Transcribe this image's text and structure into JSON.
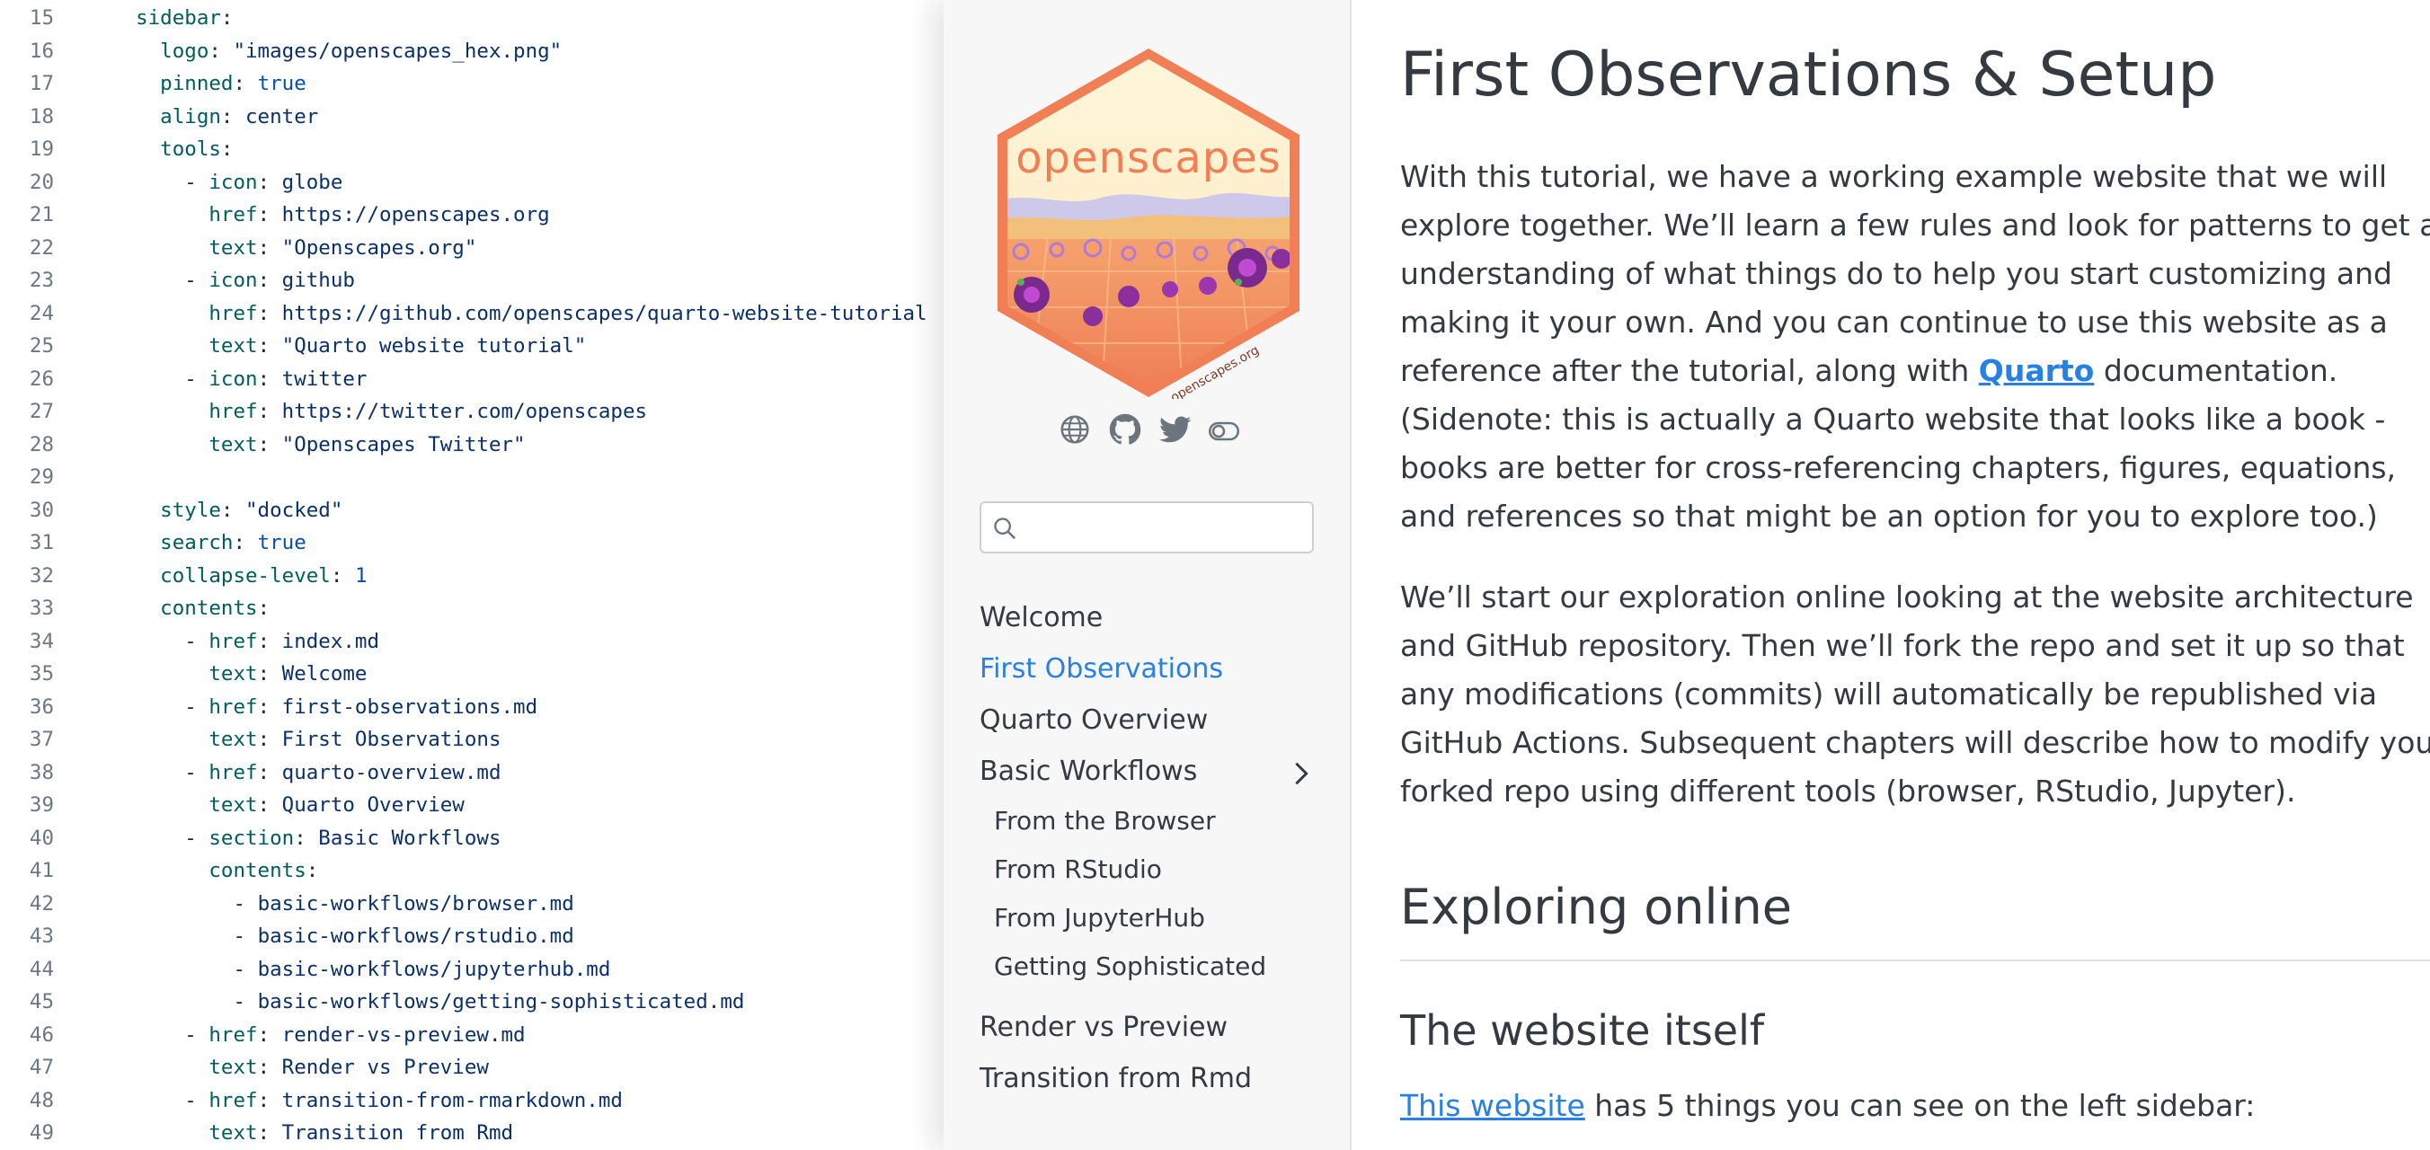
{
  "code": {
    "lines": [
      {
        "n": "15",
        "parts": [
          {
            "c": "k",
            "t": "  sidebar"
          },
          {
            "c": "p",
            "t": ":"
          }
        ]
      },
      {
        "n": "16",
        "parts": [
          {
            "c": "k",
            "t": "    logo"
          },
          {
            "c": "p",
            "t": ": "
          },
          {
            "c": "s",
            "t": "\"images/openscapes_hex.png\""
          }
        ]
      },
      {
        "n": "17",
        "parts": [
          {
            "c": "k",
            "t": "    pinned"
          },
          {
            "c": "p",
            "t": ": "
          },
          {
            "c": "n",
            "t": "true"
          }
        ]
      },
      {
        "n": "18",
        "parts": [
          {
            "c": "k",
            "t": "    align"
          },
          {
            "c": "p",
            "t": ": "
          },
          {
            "c": "s",
            "t": "center"
          }
        ]
      },
      {
        "n": "19",
        "parts": [
          {
            "c": "k",
            "t": "    tools"
          },
          {
            "c": "p",
            "t": ":"
          }
        ]
      },
      {
        "n": "20",
        "parts": [
          {
            "c": "p",
            "t": "      - "
          },
          {
            "c": "k",
            "t": "icon"
          },
          {
            "c": "p",
            "t": ": "
          },
          {
            "c": "s",
            "t": "globe"
          }
        ]
      },
      {
        "n": "21",
        "parts": [
          {
            "c": "k",
            "t": "        href"
          },
          {
            "c": "p",
            "t": ": "
          },
          {
            "c": "s",
            "t": "https://openscapes.org"
          }
        ]
      },
      {
        "n": "22",
        "parts": [
          {
            "c": "k",
            "t": "        text"
          },
          {
            "c": "p",
            "t": ": "
          },
          {
            "c": "s",
            "t": "\"Openscapes.org\""
          }
        ]
      },
      {
        "n": "23",
        "parts": [
          {
            "c": "p",
            "t": "      - "
          },
          {
            "c": "k",
            "t": "icon"
          },
          {
            "c": "p",
            "t": ": "
          },
          {
            "c": "s",
            "t": "github"
          }
        ]
      },
      {
        "n": "24",
        "parts": [
          {
            "c": "k",
            "t": "        href"
          },
          {
            "c": "p",
            "t": ": "
          },
          {
            "c": "s",
            "t": "https://github.com/openscapes/quarto-website-tutorial"
          }
        ]
      },
      {
        "n": "25",
        "parts": [
          {
            "c": "k",
            "t": "        text"
          },
          {
            "c": "p",
            "t": ": "
          },
          {
            "c": "s",
            "t": "\"Quarto website tutorial\""
          }
        ]
      },
      {
        "n": "26",
        "parts": [
          {
            "c": "p",
            "t": "      - "
          },
          {
            "c": "k",
            "t": "icon"
          },
          {
            "c": "p",
            "t": ": "
          },
          {
            "c": "s",
            "t": "twitter"
          }
        ]
      },
      {
        "n": "27",
        "parts": [
          {
            "c": "k",
            "t": "        href"
          },
          {
            "c": "p",
            "t": ": "
          },
          {
            "c": "s",
            "t": "https://twitter.com/openscapes"
          }
        ]
      },
      {
        "n": "28",
        "parts": [
          {
            "c": "k",
            "t": "        text"
          },
          {
            "c": "p",
            "t": ": "
          },
          {
            "c": "s",
            "t": "\"Openscapes Twitter\""
          }
        ]
      },
      {
        "n": "29",
        "parts": []
      },
      {
        "n": "30",
        "parts": [
          {
            "c": "k",
            "t": "    style"
          },
          {
            "c": "p",
            "t": ": "
          },
          {
            "c": "s",
            "t": "\"docked\""
          }
        ]
      },
      {
        "n": "31",
        "parts": [
          {
            "c": "k",
            "t": "    search"
          },
          {
            "c": "p",
            "t": ": "
          },
          {
            "c": "n",
            "t": "true"
          }
        ]
      },
      {
        "n": "32",
        "parts": [
          {
            "c": "k",
            "t": "    collapse-level"
          },
          {
            "c": "p",
            "t": ": "
          },
          {
            "c": "n",
            "t": "1"
          }
        ]
      },
      {
        "n": "33",
        "parts": [
          {
            "c": "k",
            "t": "    contents"
          },
          {
            "c": "p",
            "t": ":"
          }
        ]
      },
      {
        "n": "34",
        "parts": [
          {
            "c": "p",
            "t": "      - "
          },
          {
            "c": "k",
            "t": "href"
          },
          {
            "c": "p",
            "t": ": "
          },
          {
            "c": "s",
            "t": "index.md"
          }
        ]
      },
      {
        "n": "35",
        "parts": [
          {
            "c": "k",
            "t": "        text"
          },
          {
            "c": "p",
            "t": ": "
          },
          {
            "c": "s",
            "t": "Welcome"
          }
        ]
      },
      {
        "n": "36",
        "parts": [
          {
            "c": "p",
            "t": "      - "
          },
          {
            "c": "k",
            "t": "href"
          },
          {
            "c": "p",
            "t": ": "
          },
          {
            "c": "s",
            "t": "first-observations.md"
          }
        ]
      },
      {
        "n": "37",
        "parts": [
          {
            "c": "k",
            "t": "        text"
          },
          {
            "c": "p",
            "t": ": "
          },
          {
            "c": "s",
            "t": "First Observations"
          }
        ]
      },
      {
        "n": "38",
        "parts": [
          {
            "c": "p",
            "t": "      - "
          },
          {
            "c": "k",
            "t": "href"
          },
          {
            "c": "p",
            "t": ": "
          },
          {
            "c": "s",
            "t": "quarto-overview.md"
          }
        ]
      },
      {
        "n": "39",
        "parts": [
          {
            "c": "k",
            "t": "        text"
          },
          {
            "c": "p",
            "t": ": "
          },
          {
            "c": "s",
            "t": "Quarto Overview"
          }
        ]
      },
      {
        "n": "40",
        "parts": [
          {
            "c": "p",
            "t": "      - "
          },
          {
            "c": "k",
            "t": "section"
          },
          {
            "c": "p",
            "t": ": "
          },
          {
            "c": "s",
            "t": "Basic Workflows"
          }
        ]
      },
      {
        "n": "41",
        "parts": [
          {
            "c": "k",
            "t": "        contents"
          },
          {
            "c": "p",
            "t": ":"
          }
        ]
      },
      {
        "n": "42",
        "parts": [
          {
            "c": "p",
            "t": "          - "
          },
          {
            "c": "s",
            "t": "basic-workflows/browser.md"
          }
        ]
      },
      {
        "n": "43",
        "parts": [
          {
            "c": "p",
            "t": "          - "
          },
          {
            "c": "s",
            "t": "basic-workflows/rstudio.md"
          }
        ]
      },
      {
        "n": "44",
        "parts": [
          {
            "c": "p",
            "t": "          - "
          },
          {
            "c": "s",
            "t": "basic-workflows/jupyterhub.md"
          }
        ]
      },
      {
        "n": "45",
        "parts": [
          {
            "c": "p",
            "t": "          - "
          },
          {
            "c": "s",
            "t": "basic-workflows/getting-sophisticated.md"
          }
        ]
      },
      {
        "n": "46",
        "parts": [
          {
            "c": "p",
            "t": "      - "
          },
          {
            "c": "k",
            "t": "href"
          },
          {
            "c": "p",
            "t": ": "
          },
          {
            "c": "s",
            "t": "render-vs-preview.md"
          }
        ]
      },
      {
        "n": "47",
        "parts": [
          {
            "c": "k",
            "t": "        text"
          },
          {
            "c": "p",
            "t": ": "
          },
          {
            "c": "s",
            "t": "Render vs Preview"
          }
        ]
      },
      {
        "n": "48",
        "parts": [
          {
            "c": "p",
            "t": "      - "
          },
          {
            "c": "k",
            "t": "href"
          },
          {
            "c": "p",
            "t": ": "
          },
          {
            "c": "s",
            "t": "transition-from-rmarkdown.md"
          }
        ]
      },
      {
        "n": "49",
        "parts": [
          {
            "c": "k",
            "t": "        text"
          },
          {
            "c": "p",
            "t": ": "
          },
          {
            "c": "s",
            "t": "Transition from Rmd"
          }
        ]
      }
    ]
  },
  "sidebar": {
    "logo_text": "openscapes",
    "logo_url_text": "openscapes.org",
    "tools": [
      "globe-icon",
      "github-icon",
      "twitter-icon",
      "toggle-icon"
    ],
    "search": {
      "value": "",
      "placeholder": ""
    },
    "nav": {
      "welcome": "Welcome",
      "first_observations": "First Observations",
      "quarto_overview": "Quarto Overview",
      "basic_workflows": "Basic Workflows",
      "from_browser": "From the Browser",
      "from_rstudio": "From RStudio",
      "from_jupyterhub": "From JupyterHub",
      "getting_sophisticated": "Getting Sophisticated",
      "render_vs_preview": "Render vs Preview",
      "transition_from_rmd": "Transition from Rmd"
    }
  },
  "main": {
    "title": "First Observations & Setup",
    "p1_before": "With this tutorial, we have a working example website that we will explore together. We’ll learn a few rules and look for patterns to get an understanding of what things do to help you start customizing and making it your own. And you can continue to use this website as a reference after the tutorial, along with ",
    "p1_link": "Quarto",
    "p1_after": " documentation. (Sidenote: this is actually a Quarto website that looks like a book - books are better for cross-referencing chapters, figures, equations, and references so that might be an option for you to explore too.)",
    "p2": "We’ll start our exploration online looking at the website architecture and GitHub repository. Then we’ll fork the repo and set it up so that any modifications (commits) will automatically be republished via GitHub Actions. Subsequent chapters will describe how to modify your forked repo using different tools (browser, RStudio, Jupyter).",
    "h2": "Exploring online",
    "h3": "The website itself",
    "p3_link": "This website",
    "p3_after": " has 5 things you can see on the left sidebar:"
  },
  "colors": {
    "accent": "#2780e3",
    "text": "#343a40",
    "sidebar_bg": "#f7f7f7",
    "logo_orange": "#f07f55",
    "logo_cream": "#fdf2cf"
  }
}
